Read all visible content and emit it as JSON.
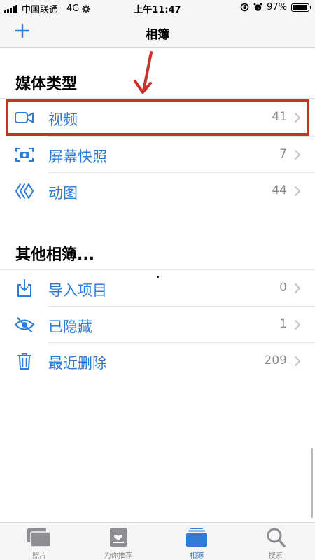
{
  "status_bar": {
    "carrier": "中国联通",
    "network": "4G",
    "time": "上午11:47",
    "battery": "97%",
    "battery_level": 0.97
  },
  "nav": {
    "title": "相簿",
    "add_icon": "plus-icon"
  },
  "media_types": {
    "title": "媒体类型",
    "items": [
      {
        "label": "视频",
        "count": "41",
        "icon": "video-camera-icon"
      },
      {
        "label": "屏幕快照",
        "count": "7",
        "icon": "screenshot-icon"
      },
      {
        "label": "动图",
        "count": "44",
        "icon": "animated-layers-icon"
      }
    ]
  },
  "other_albums": {
    "title": "其他相簿...",
    "items": [
      {
        "label": "导入项目",
        "count": "0",
        "icon": "import-icon"
      },
      {
        "label": "已隐藏",
        "count": "1",
        "icon": "eye-slash-icon"
      },
      {
        "label": "最近删除",
        "count": "209",
        "icon": "trash-icon"
      }
    ]
  },
  "tabs": [
    {
      "label": "照片",
      "icon": "photos-icon",
      "active": false
    },
    {
      "label": "为你推荐",
      "icon": "for-you-icon",
      "active": false
    },
    {
      "label": "相簿",
      "icon": "albums-icon",
      "active": true
    },
    {
      "label": "搜索",
      "icon": "search-icon",
      "active": false
    }
  ],
  "colors": {
    "accent": "#2f7bd8",
    "annotation": "#c9302c",
    "secondary_text": "#8a8a8e"
  }
}
